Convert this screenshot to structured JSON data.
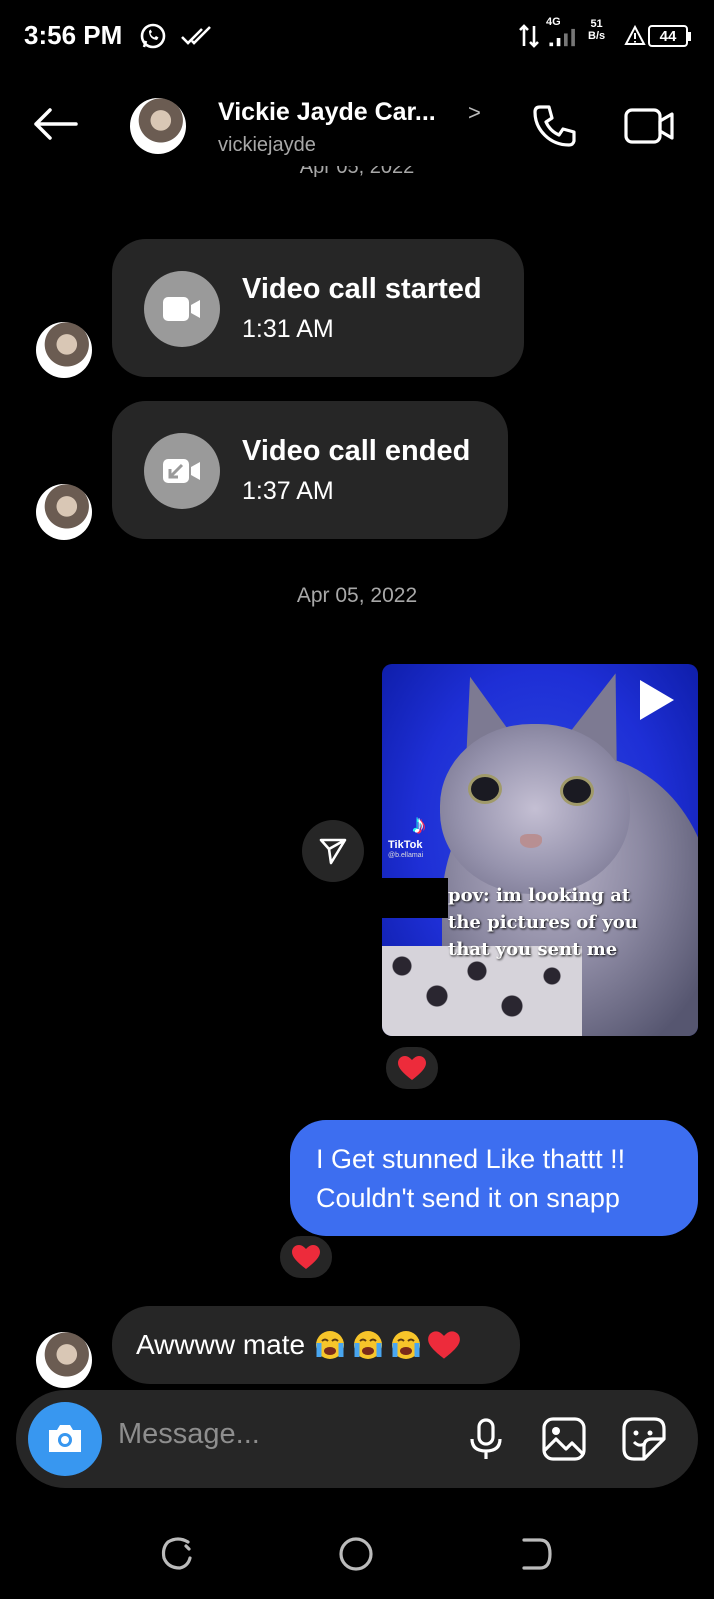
{
  "status_bar": {
    "time": "3:56 PM",
    "network": "4G",
    "speed_value": "51",
    "speed_unit": "B/s",
    "battery": "44",
    "icons": [
      "whatsapp-icon",
      "double-check-icon",
      "data-arrows-icon",
      "signal-icon",
      "warning-icon",
      "battery-icon"
    ]
  },
  "header": {
    "name": "Vickie Jayde Car...",
    "username": "vickiejayde",
    "chevron": ">",
    "icons": [
      "back-arrow-icon",
      "phone-icon",
      "video-camera-icon"
    ]
  },
  "chat": {
    "date_top": "Apr 05, 2022",
    "calls": [
      {
        "title": "Video call started",
        "time": "1:31 AM",
        "icon": "video-camera-icon"
      },
      {
        "title": "Video call ended",
        "time": "1:37 AM",
        "icon": "video-missed-icon"
      }
    ],
    "date_mid": "Apr 05, 2022",
    "shared_video": {
      "source": "TikTok",
      "source_user": "@b.ellamai",
      "caption_lines": [
        "pov: im looking at",
        "the pictures of you",
        "that you sent me"
      ],
      "reaction": "heart"
    },
    "outgoing_message": {
      "lines": [
        "I Get stunned Like thattt !!",
        "Couldn't send it on snapp"
      ],
      "reaction": "heart"
    },
    "incoming_message": {
      "text": "Awwww mate",
      "emojis": [
        "crying-face",
        "crying-face",
        "crying-face",
        "red-heart"
      ]
    }
  },
  "composer": {
    "placeholder": "Message...",
    "icons": [
      "camera-icon",
      "microphone-icon",
      "gallery-icon",
      "sticker-icon"
    ]
  },
  "nav": {
    "icons": [
      "recents-icon",
      "home-icon",
      "back-icon"
    ]
  },
  "colors": {
    "background": "#000000",
    "bubble_dark": "#262626",
    "bubble_outgoing": "#3d6ef0",
    "camera_button": "#3897f0",
    "secondary_text": "#a8a8a8",
    "heart": "#ed2b3b"
  }
}
